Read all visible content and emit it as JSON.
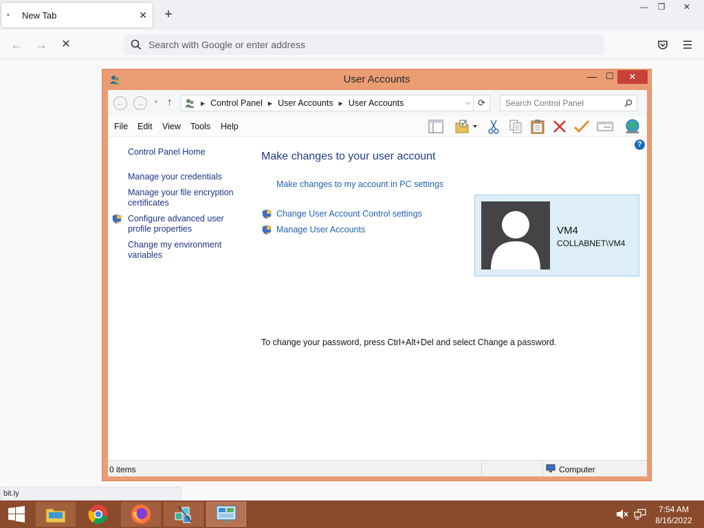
{
  "browser": {
    "tab": {
      "title": "New Tab",
      "close": "✕"
    },
    "new_tab": "+",
    "window_controls": {
      "minimize": "—",
      "restore": "❐",
      "close": "✕"
    },
    "nav": {
      "back": "←",
      "forward": "→",
      "stop": "✕"
    },
    "address_placeholder": "Search with Google or enter address",
    "status_url": "bit.ly"
  },
  "dialog": {
    "title": "User Accounts",
    "controls": {
      "minimize": "—",
      "maximize": "☐",
      "close": "✕"
    },
    "address": {
      "crumbs": [
        "Control Panel",
        "User Accounts",
        "User Accounts"
      ],
      "search_placeholder": "Search Control Panel"
    },
    "menu": [
      "File",
      "Edit",
      "View",
      "Tools",
      "Help"
    ],
    "toolbar_icons": [
      "layout-icon",
      "folder-options-icon",
      "cut-icon",
      "copy-icon",
      "paste-icon",
      "delete-icon",
      "checkmark-icon",
      "properties-icon",
      "network-globe-icon"
    ],
    "left_pane": {
      "home": "Control Panel Home",
      "links": [
        "Manage your credentials",
        "Manage your file encryption certificates",
        "Configure advanced user profile properties",
        "Change my environment variables"
      ]
    },
    "main": {
      "heading": "Make changes to your user account",
      "pc_settings_link": "Make changes to my account in PC settings",
      "uac_link": "Change User Account Control settings",
      "manage_link": "Manage User Accounts",
      "password_note": "To change your password, press Ctrl+Alt+Del and select Change a password."
    },
    "user": {
      "name": "VM4",
      "domain": "COLLABNET\\VM4"
    },
    "status": {
      "items": "0 items",
      "location": "Computer"
    },
    "help": "?"
  },
  "taskbar": {
    "time": "7:54 AM",
    "date": "8/16/2022"
  },
  "colors": {
    "window_frame": "#ea9c72",
    "taskbar": "#8a4a2c",
    "link": "#1e62b0",
    "heading": "#1e3b86",
    "usercard_bg": "#ddeef9"
  }
}
